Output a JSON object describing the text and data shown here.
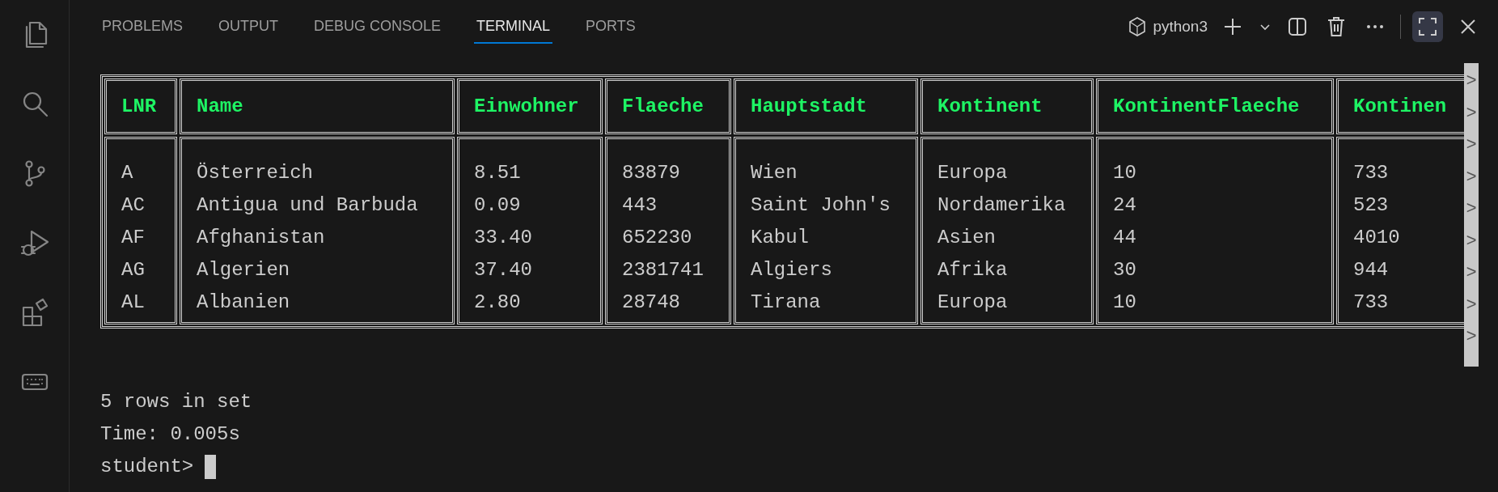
{
  "tabs": [
    {
      "label": "PROBLEMS",
      "selected": false
    },
    {
      "label": "OUTPUT",
      "selected": false
    },
    {
      "label": "DEBUG CONSOLE",
      "selected": false
    },
    {
      "label": "TERMINAL",
      "selected": true
    },
    {
      "label": "PORTS",
      "selected": false
    }
  ],
  "toolbar": {
    "profile": "python3"
  },
  "table": {
    "columns": [
      "LNR",
      "Name",
      "Einwohner",
      "Flaeche",
      "Hauptstadt",
      "Kontinent",
      "KontinentFlaeche",
      "Kontinen"
    ],
    "rows": [
      [
        "A",
        "Österreich",
        "8.51",
        "83879",
        "Wien",
        "Europa",
        "10",
        "733"
      ],
      [
        "AC",
        "Antigua und Barbuda",
        "0.09",
        "443",
        "Saint John's",
        "Nordamerika",
        "24",
        "523"
      ],
      [
        "AF",
        "Afghanistan",
        "33.40",
        "652230",
        "Kabul",
        "Asien",
        "44",
        "4010"
      ],
      [
        "AG",
        "Algerien",
        "37.40",
        "2381741",
        "Algiers",
        "Afrika",
        "30",
        "944"
      ],
      [
        "AL",
        "Albanien",
        "2.80",
        "28748",
        "Tirana",
        "Europa",
        "10",
        "733"
      ]
    ]
  },
  "overflow_markers": [
    ">",
    ">",
    ">",
    ">",
    ">",
    ">",
    ">",
    ">",
    ">"
  ],
  "output": [
    "5 rows in set",
    "Time: 0.005s"
  ],
  "prompt": "student>"
}
